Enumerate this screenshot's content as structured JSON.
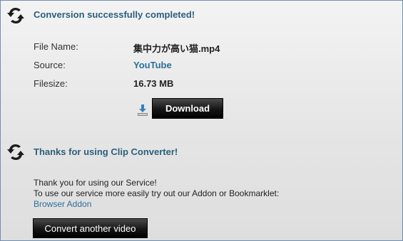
{
  "conversion": {
    "title": "Conversion successfully completed!",
    "file_name_label": "File Name:",
    "file_name_value": "集中力が高い猫.mp4",
    "source_label": "Source:",
    "source_value": "YouTube",
    "filesize_label": "Filesize:",
    "filesize_value": "16.73 MB",
    "download_label": "Download"
  },
  "thanks": {
    "title": "Thanks for using Clip Converter!",
    "line1": "Thank you for using our Service!",
    "line2": "To use our service more easily try out our Addon or Bookmarklet:",
    "addon_link": "Browser Addon",
    "convert_label": "Convert another video"
  },
  "icons": {
    "section": "convert-arrows-icon",
    "download": "download-icon"
  },
  "colors": {
    "heading": "#2b5f7c",
    "link": "#2b6f99",
    "button": "#111111"
  }
}
